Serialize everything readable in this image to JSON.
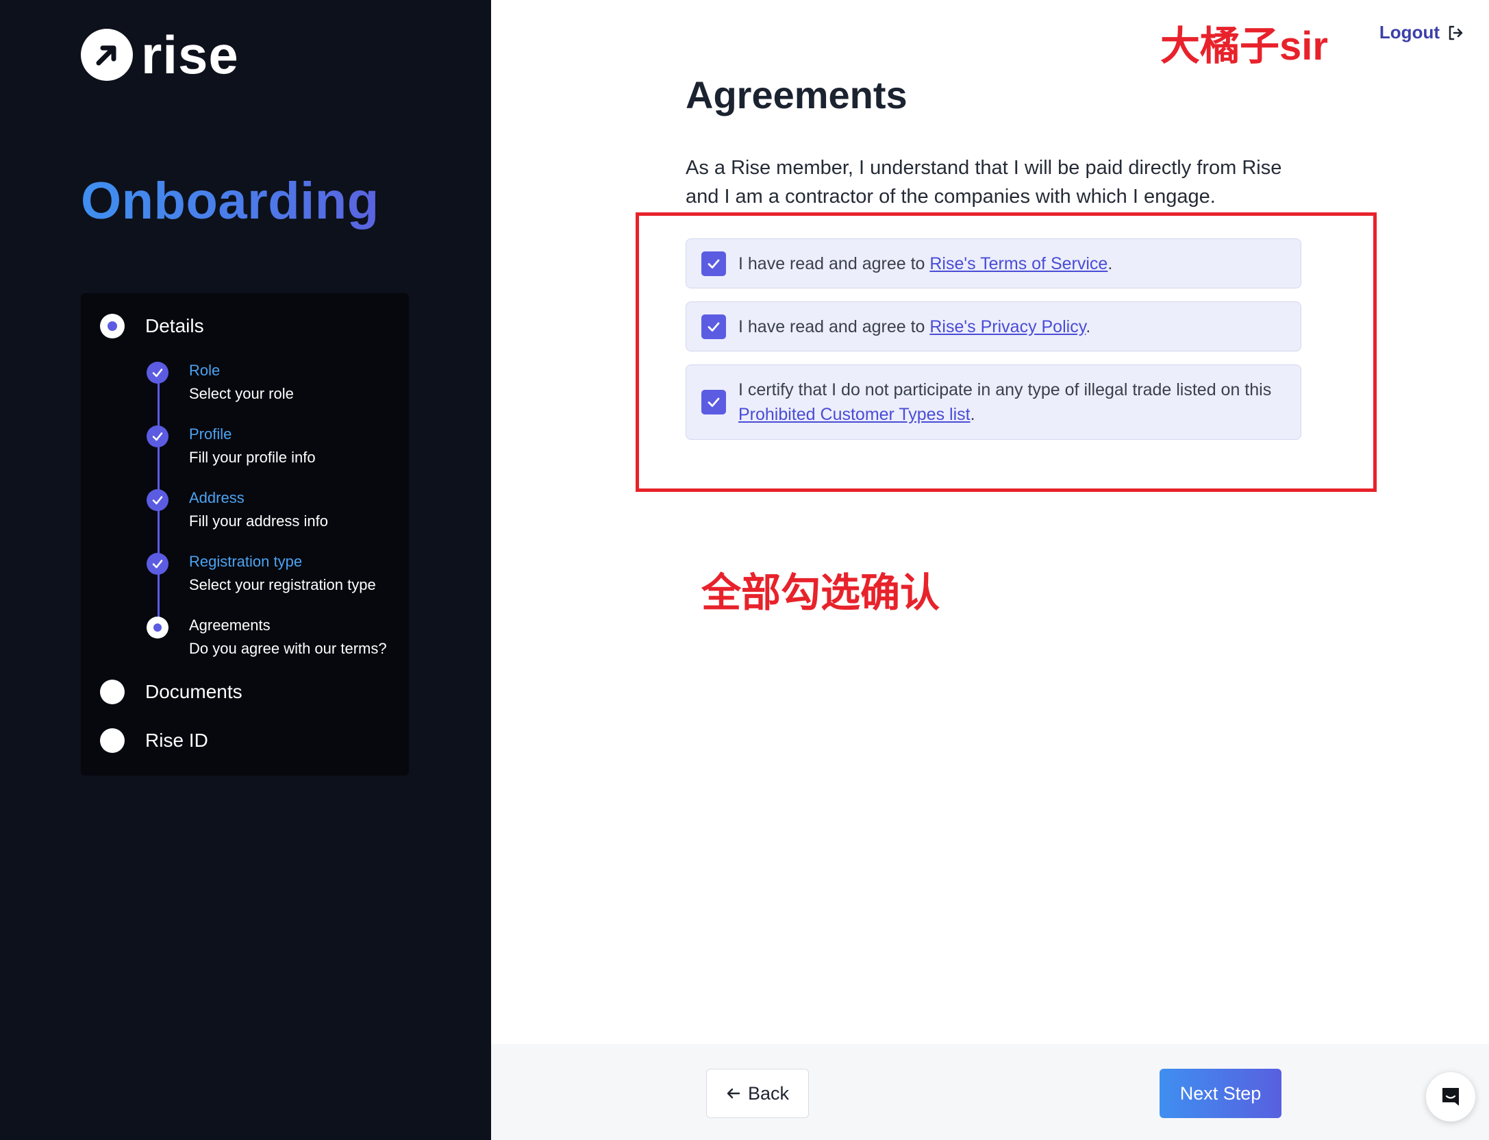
{
  "sidebar": {
    "logo_text": "rise",
    "title": "Onboarding",
    "steps": [
      {
        "label": "Details",
        "substeps": [
          {
            "title": "Role",
            "desc": "Select your role",
            "status": "done"
          },
          {
            "title": "Profile",
            "desc": "Fill your profile info",
            "status": "done"
          },
          {
            "title": "Address",
            "desc": "Fill your address info",
            "status": "done"
          },
          {
            "title": "Registration type",
            "desc": "Select your registration type",
            "status": "done"
          },
          {
            "title": "Agreements",
            "desc": "Do you agree with our terms?",
            "status": "current"
          }
        ]
      },
      {
        "label": "Documents"
      },
      {
        "label": "Rise ID"
      }
    ]
  },
  "header": {
    "logout_label": "Logout",
    "watermark": "大橘子sir"
  },
  "main": {
    "title": "Agreements",
    "intro": "As a Rise member, I understand that I will be paid directly from Rise and I am a contractor of the companies with which I engage.",
    "agreements": [
      {
        "prefix": "I have read and agree to ",
        "link": "Rise's Terms of Service",
        "suffix": ".",
        "checked": true
      },
      {
        "prefix": "I have read and agree to ",
        "link": "Rise's Privacy Policy",
        "suffix": ".",
        "checked": true
      },
      {
        "prefix": "I certify that I do not participate in any type of illegal trade listed on this ",
        "link": "Prohibited Customer Types list",
        "suffix": ".",
        "checked": true
      }
    ],
    "annotation": "全部勾选确认"
  },
  "footer": {
    "back_label": "Back",
    "next_label": "Next Step"
  },
  "colors": {
    "sidebar_bg": "#0d111b",
    "accent": "#5b5ce2",
    "link": "#4a4cd6",
    "annotation_red": "#e8222b",
    "gradient_start": "#3f8ff0",
    "gradient_end": "#5860e0"
  },
  "icons": {
    "logo": "arrow-up-right-circle-icon",
    "logout": "logout-arrow-icon",
    "check": "checkmark-icon",
    "back": "arrow-left-icon",
    "chat": "chat-bubble-icon"
  }
}
